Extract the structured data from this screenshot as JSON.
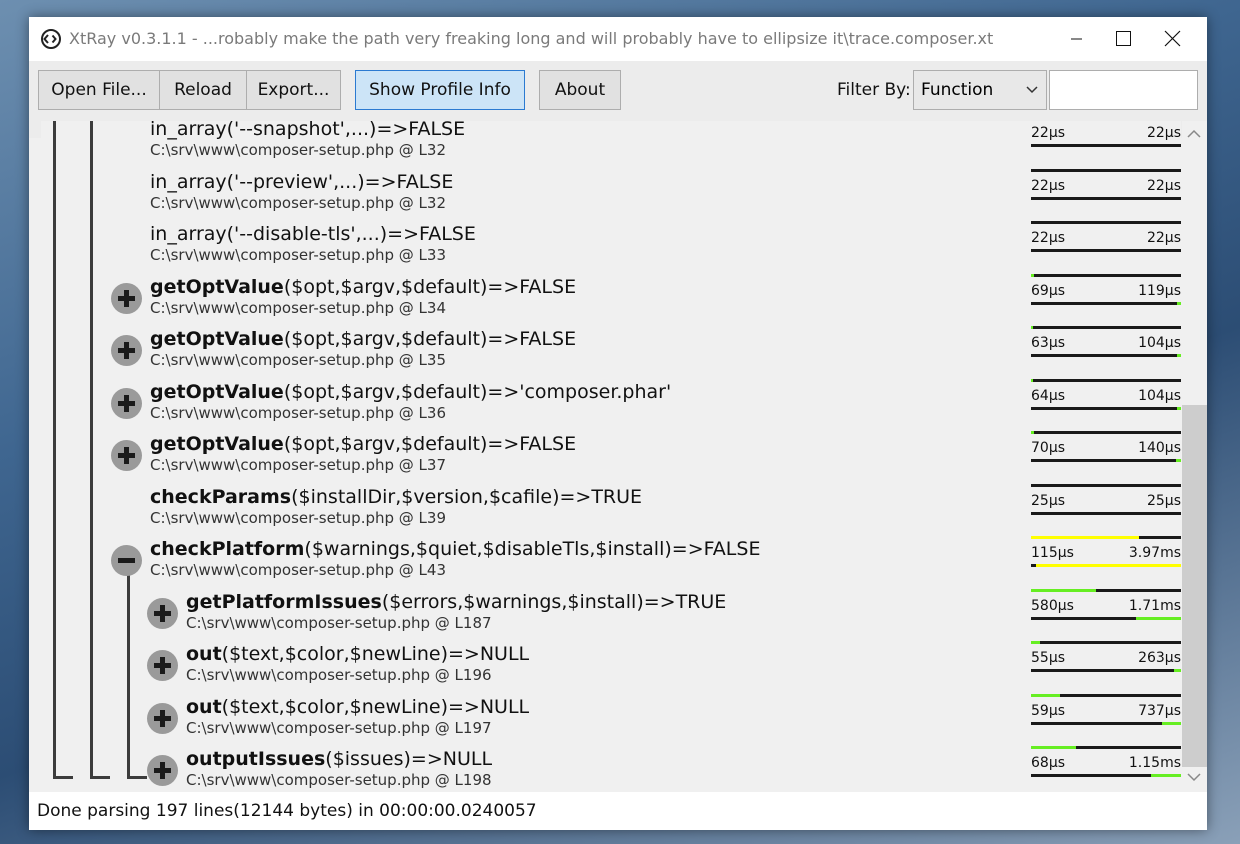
{
  "window": {
    "title": "XtRay v0.3.1.1 - ...robably make the path very freaking long and will probably have to ellipsize it\\trace.composer.xt"
  },
  "toolbar": {
    "open_label": "Open File...",
    "reload_label": "Reload",
    "export_label": "Export...",
    "profile_label": "Show Profile Info",
    "about_label": "About",
    "filter_label": "Filter By:",
    "filter_value": "Function",
    "filter_text": ""
  },
  "colors": {
    "ok": "#66ee22",
    "hot": "#ffff00",
    "bar": "#1a1a1a"
  },
  "rows": [
    {
      "expander": "none",
      "name": "in_array",
      "args": "('--snapshot',...)=>FALSE",
      "location": "C:\\srv\\www\\composer-setup.php @ L32",
      "self_time": "22µs",
      "total_time": "22µs",
      "self_fraction": 0,
      "total_fraction": 0,
      "color": "ok"
    },
    {
      "expander": "none",
      "name": "in_array",
      "args": "('--preview',...)=>FALSE",
      "location": "C:\\srv\\www\\composer-setup.php @ L32",
      "self_time": "22µs",
      "total_time": "22µs",
      "self_fraction": 0,
      "total_fraction": 0,
      "color": "ok"
    },
    {
      "expander": "none",
      "name": "in_array",
      "args": "('--disable-tls',...)=>FALSE",
      "location": "C:\\srv\\www\\composer-setup.php @ L33",
      "self_time": "22µs",
      "total_time": "22µs",
      "self_fraction": 0,
      "total_fraction": 0,
      "color": "ok"
    },
    {
      "expander": "plus",
      "name": "getOptValue",
      "args": "($opt,$argv,$default)=>FALSE",
      "location": "C:\\srv\\www\\composer-setup.php @ L34",
      "self_time": "69µs",
      "total_time": "119µs",
      "self_fraction": 0.017,
      "total_fraction": 0.03,
      "color": "ok"
    },
    {
      "expander": "plus",
      "name": "getOptValue",
      "args": "($opt,$argv,$default)=>FALSE",
      "location": "C:\\srv\\www\\composer-setup.php @ L35",
      "self_time": "63µs",
      "total_time": "104µs",
      "self_fraction": 0.016,
      "total_fraction": 0.026,
      "color": "ok"
    },
    {
      "expander": "plus",
      "name": "getOptValue",
      "args": "($opt,$argv,$default)=>'composer.phar'",
      "location": "C:\\srv\\www\\composer-setup.php @ L36",
      "self_time": "64µs",
      "total_time": "104µs",
      "self_fraction": 0.016,
      "total_fraction": 0.026,
      "color": "ok"
    },
    {
      "expander": "plus",
      "name": "getOptValue",
      "args": "($opt,$argv,$default)=>FALSE",
      "location": "C:\\srv\\www\\composer-setup.php @ L37",
      "self_time": "70µs",
      "total_time": "140µs",
      "self_fraction": 0.018,
      "total_fraction": 0.035,
      "color": "ok"
    },
    {
      "expander": "none",
      "name": "checkParams",
      "args": "($installDir,$version,$cafile)=>TRUE",
      "location": "C:\\srv\\www\\composer-setup.php @ L39",
      "self_time": "25µs",
      "total_time": "25µs",
      "self_fraction": 0,
      "total_fraction": 0,
      "color": "ok"
    },
    {
      "expander": "minus",
      "name": "checkPlatform",
      "args": "($warnings,$quiet,$disableTls,$install)=>FALSE",
      "location": "C:\\srv\\www\\composer-setup.php @ L43",
      "self_time": "115µs",
      "total_time": "3.97ms",
      "self_fraction": 0.72,
      "total_fraction": 0.97,
      "color": "hot"
    },
    {
      "expander": "plus",
      "name": "getPlatformIssues",
      "args": "($errors,$warnings,$install)=>TRUE",
      "location": "C:\\srv\\www\\composer-setup.php @ L187",
      "self_time": "580µs",
      "total_time": "1.71ms",
      "self_fraction": 0.43,
      "total_fraction": 0.3,
      "color": "ok"
    },
    {
      "expander": "plus",
      "name": "out",
      "args": "($text,$color,$newLine)=>NULL",
      "location": "C:\\srv\\www\\composer-setup.php @ L196",
      "self_time": "55µs",
      "total_time": "263µs",
      "self_fraction": 0.06,
      "total_fraction": 0.05,
      "color": "ok"
    },
    {
      "expander": "plus",
      "name": "out",
      "args": "($text,$color,$newLine)=>NULL",
      "location": "C:\\srv\\www\\composer-setup.php @ L197",
      "self_time": "59µs",
      "total_time": "737µs",
      "self_fraction": 0.19,
      "total_fraction": 0.13,
      "color": "ok"
    },
    {
      "expander": "plus",
      "name": "outputIssues",
      "args": "($issues)=>NULL",
      "location": "C:\\srv\\www\\composer-setup.php @ L198",
      "self_time": "68µs",
      "total_time": "1.15ms",
      "self_fraction": 0.3,
      "total_fraction": 0.2,
      "color": "ok"
    }
  ],
  "status": {
    "text": "Done parsing 197 lines(12144 bytes) in 00:00:00.0240057"
  }
}
